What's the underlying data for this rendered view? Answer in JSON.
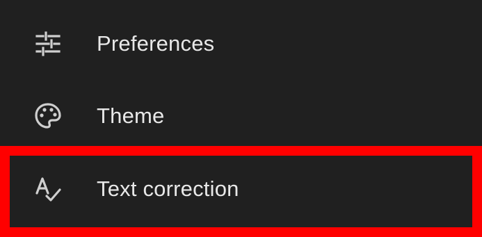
{
  "menu": {
    "items": [
      {
        "label": "Preferences",
        "icon": "sliders-icon"
      },
      {
        "label": "Theme",
        "icon": "palette-icon"
      },
      {
        "label": "Text correction",
        "icon": "spellcheck-icon",
        "highlighted": true
      }
    ]
  },
  "colors": {
    "background": "#202020",
    "text": "#e8e8e8",
    "icon": "#cfcfcf",
    "highlight_border": "#ff0000"
  }
}
